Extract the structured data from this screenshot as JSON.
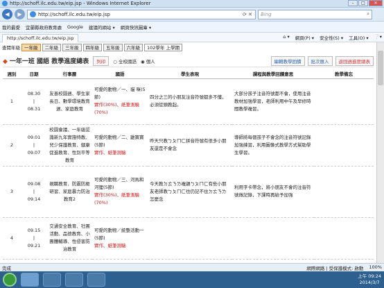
{
  "browser": {
    "window_title": "http://schoff.ilc.edu.tw/eip.jsp - Windows Internet Explorer",
    "url": "http://schoff.ilc.edu.tw/eip.jsp",
    "search_placeholder": "Bing",
    "tab_label": "http://schoff.ilc.edu.tw/eip.jsp",
    "favorites": [
      "我的最愛",
      "宜蘭縣政府教育處",
      "Google",
      "建議的網站 ▾",
      "網頁快訊圖庫 ▾"
    ],
    "tools": [
      "網頁(P) ▾",
      "安全性(S) ▾",
      "工具(O) ▾"
    ],
    "status_left": "完成",
    "status_right": "網際網路 | 受保護模式: 啟動",
    "zoom": "100%"
  },
  "grades": {
    "label": "查閱年級",
    "tabs": [
      "一年級",
      "二年級",
      "三年級",
      "四年級",
      "五年級",
      "六年級"
    ],
    "year_select": "102學年 上學期"
  },
  "header": {
    "title": "一年一班 國語 教學進度總表",
    "print": "列印",
    "radio_all": "全校國語",
    "radio_personal": "個人",
    "btn_edit": "編輯教學回饋",
    "btn_import": "批次匯入",
    "btn_back": "返回週進度總表"
  },
  "table": {
    "columns": [
      "週別",
      "日期",
      "行事曆",
      "國語",
      "學生表現",
      "課程與教學回饋意思",
      "教學備忘"
    ],
    "rows": [
      {
        "week": "1",
        "date_from": "08.30",
        "date_sep": "|",
        "date_to": "08.31",
        "calendar": "友善校園週、學生家長日、數學環境教育週、家庭教育",
        "lesson": "可愛的動物／一、貓 咪(5節)",
        "assessment": "實作(30%)、紙筆測驗(70%)",
        "performance": "四分之三的小朋友注音符號都多不懂，必須從頭教起。",
        "feedback": "大部分孩子注音符號都不會，使用注音教材加強學習，老師利用中午及早修時間教學複習。",
        "memo": ""
      },
      {
        "week": "2",
        "date_from": "09.01",
        "date_sep": "|",
        "date_to": "09.07",
        "calendar": "校園會議、一年級認識新九年實施特教、兒少保護教育、健康促進教育、性別平等教育",
        "lesson": "可愛的動物／二、雞寶寶(5節)",
        "assessment": "實作、紙筆測驗",
        "performance": "昨天只教ㄅㄆㄇㄈ拼音符號有很多小朋友還是不會念",
        "feedback": "導師將每個孩子不會念的注音符號記錄加強練習，利用圖像式教學方式幫助學生學習。",
        "memo": ""
      },
      {
        "week": "3",
        "date_from": "09.08",
        "date_sep": "|",
        "date_to": "09.14",
        "calendar": "親職教育、防震防颱研習、家庭暴力防治教育2",
        "lesson": "可愛的動物／三、河馬和河狸(5節)",
        "assessment": "實作(30%)、紙筆測驗(70%)",
        "performance": "今天教ㄉㄊㄋㄌ複韻ㄅㄆㄇㄈ有些小朋友老師教ㄅㄆㄇㄈ也仍記不住ㄉㄊㄋㄌ怎麼念",
        "feedback": "利用字卡帶念，將小朋友不會的注音符號做記錄，下課時再給予加強",
        "memo": ""
      },
      {
        "week": "4",
        "date_from": "09.15",
        "date_sep": "|",
        "date_to": "09.21",
        "calendar": "交通安全教育、社團活動、品德教育、小團體輔導、性侵害防治教育",
        "lesson": "可愛的動物／統整活動一(5節)",
        "assessment": "實作、紙筆測驗",
        "performance": "",
        "feedback": "",
        "memo": ""
      }
    ]
  },
  "taskbar": {
    "time": "上午 09:24",
    "date": "2014/3/7"
  }
}
